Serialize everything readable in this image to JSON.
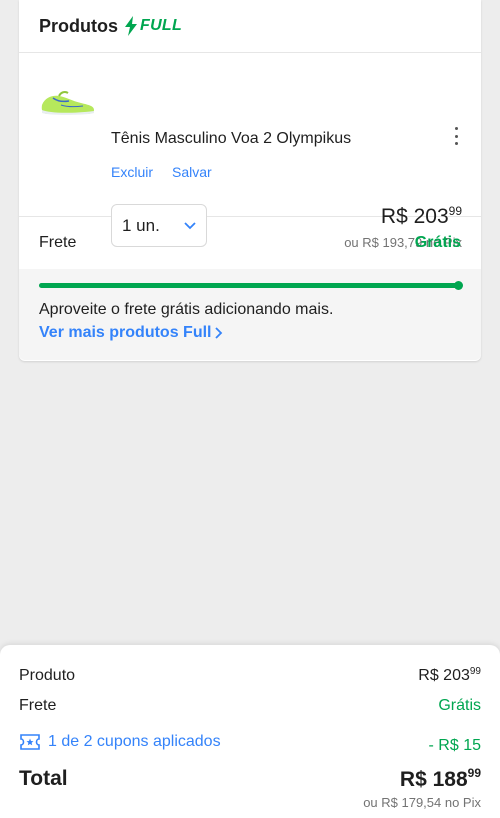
{
  "card": {
    "title": "Produtos",
    "badge": "FULL"
  },
  "product": {
    "name": "Tênis Masculino Voa 2 Olympikus",
    "actions": [
      "Excluir",
      "Salvar"
    ],
    "quantity": "1 un.",
    "price_main": "R$ 203",
    "price_cents": "99",
    "price_pix": "ou R$ 193,79 no Pix"
  },
  "frete": {
    "label": "Frete",
    "value": "Grátis"
  },
  "promo": {
    "progress_percent": 100,
    "message": "Aproveite o frete grátis adicionando mais.",
    "link": "Ver mais produtos Full"
  },
  "summary": {
    "produto_label": "Produto",
    "produto_main": "R$ 203",
    "produto_cents": "99",
    "frete_label": "Frete",
    "frete_value": "Grátis",
    "coupon_label": "1 de 2 cupons aplicados",
    "coupon_value": "- R$ 15",
    "total_label": "Total",
    "total_main": "R$ 188",
    "total_cents": "99",
    "total_pix": "ou R$ 179,54 no Pix"
  },
  "colors": {
    "accent_blue": "#3483fa",
    "green": "#00a650",
    "background": "#ededed"
  }
}
